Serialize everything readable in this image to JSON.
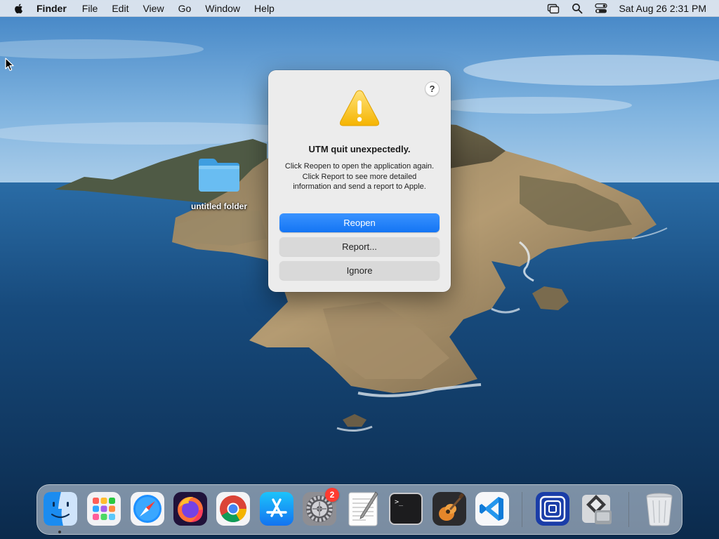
{
  "menubar": {
    "app_name": "Finder",
    "menus": [
      "File",
      "Edit",
      "View",
      "Go",
      "Window",
      "Help"
    ],
    "clock": "Sat Aug 26  2:31 PM"
  },
  "desktop": {
    "folder_label": "untitled folder"
  },
  "dialog": {
    "help_label": "?",
    "title": "UTM quit unexpectedly.",
    "message": "Click Reopen to open the application again. Click Report to see more detailed information and send a report to Apple.",
    "reopen_label": "Reopen",
    "report_label": "Report...",
    "ignore_label": "Ignore"
  },
  "dock": {
    "apps": [
      "Finder",
      "Launchpad",
      "Safari",
      "Firefox",
      "Google Chrome",
      "App Store",
      "System Preferences",
      "TextEdit",
      "Terminal",
      "GarageBand",
      "Visual Studio Code",
      "Simulator",
      "Boot Camp Assistant",
      "Trash"
    ],
    "settings_badge": "2",
    "terminal_prompt": ">_"
  },
  "colors": {
    "accent": "#1475f4",
    "badge": "#ff3b30",
    "sky": "#5e9fd3",
    "sea": "#0e3358"
  }
}
